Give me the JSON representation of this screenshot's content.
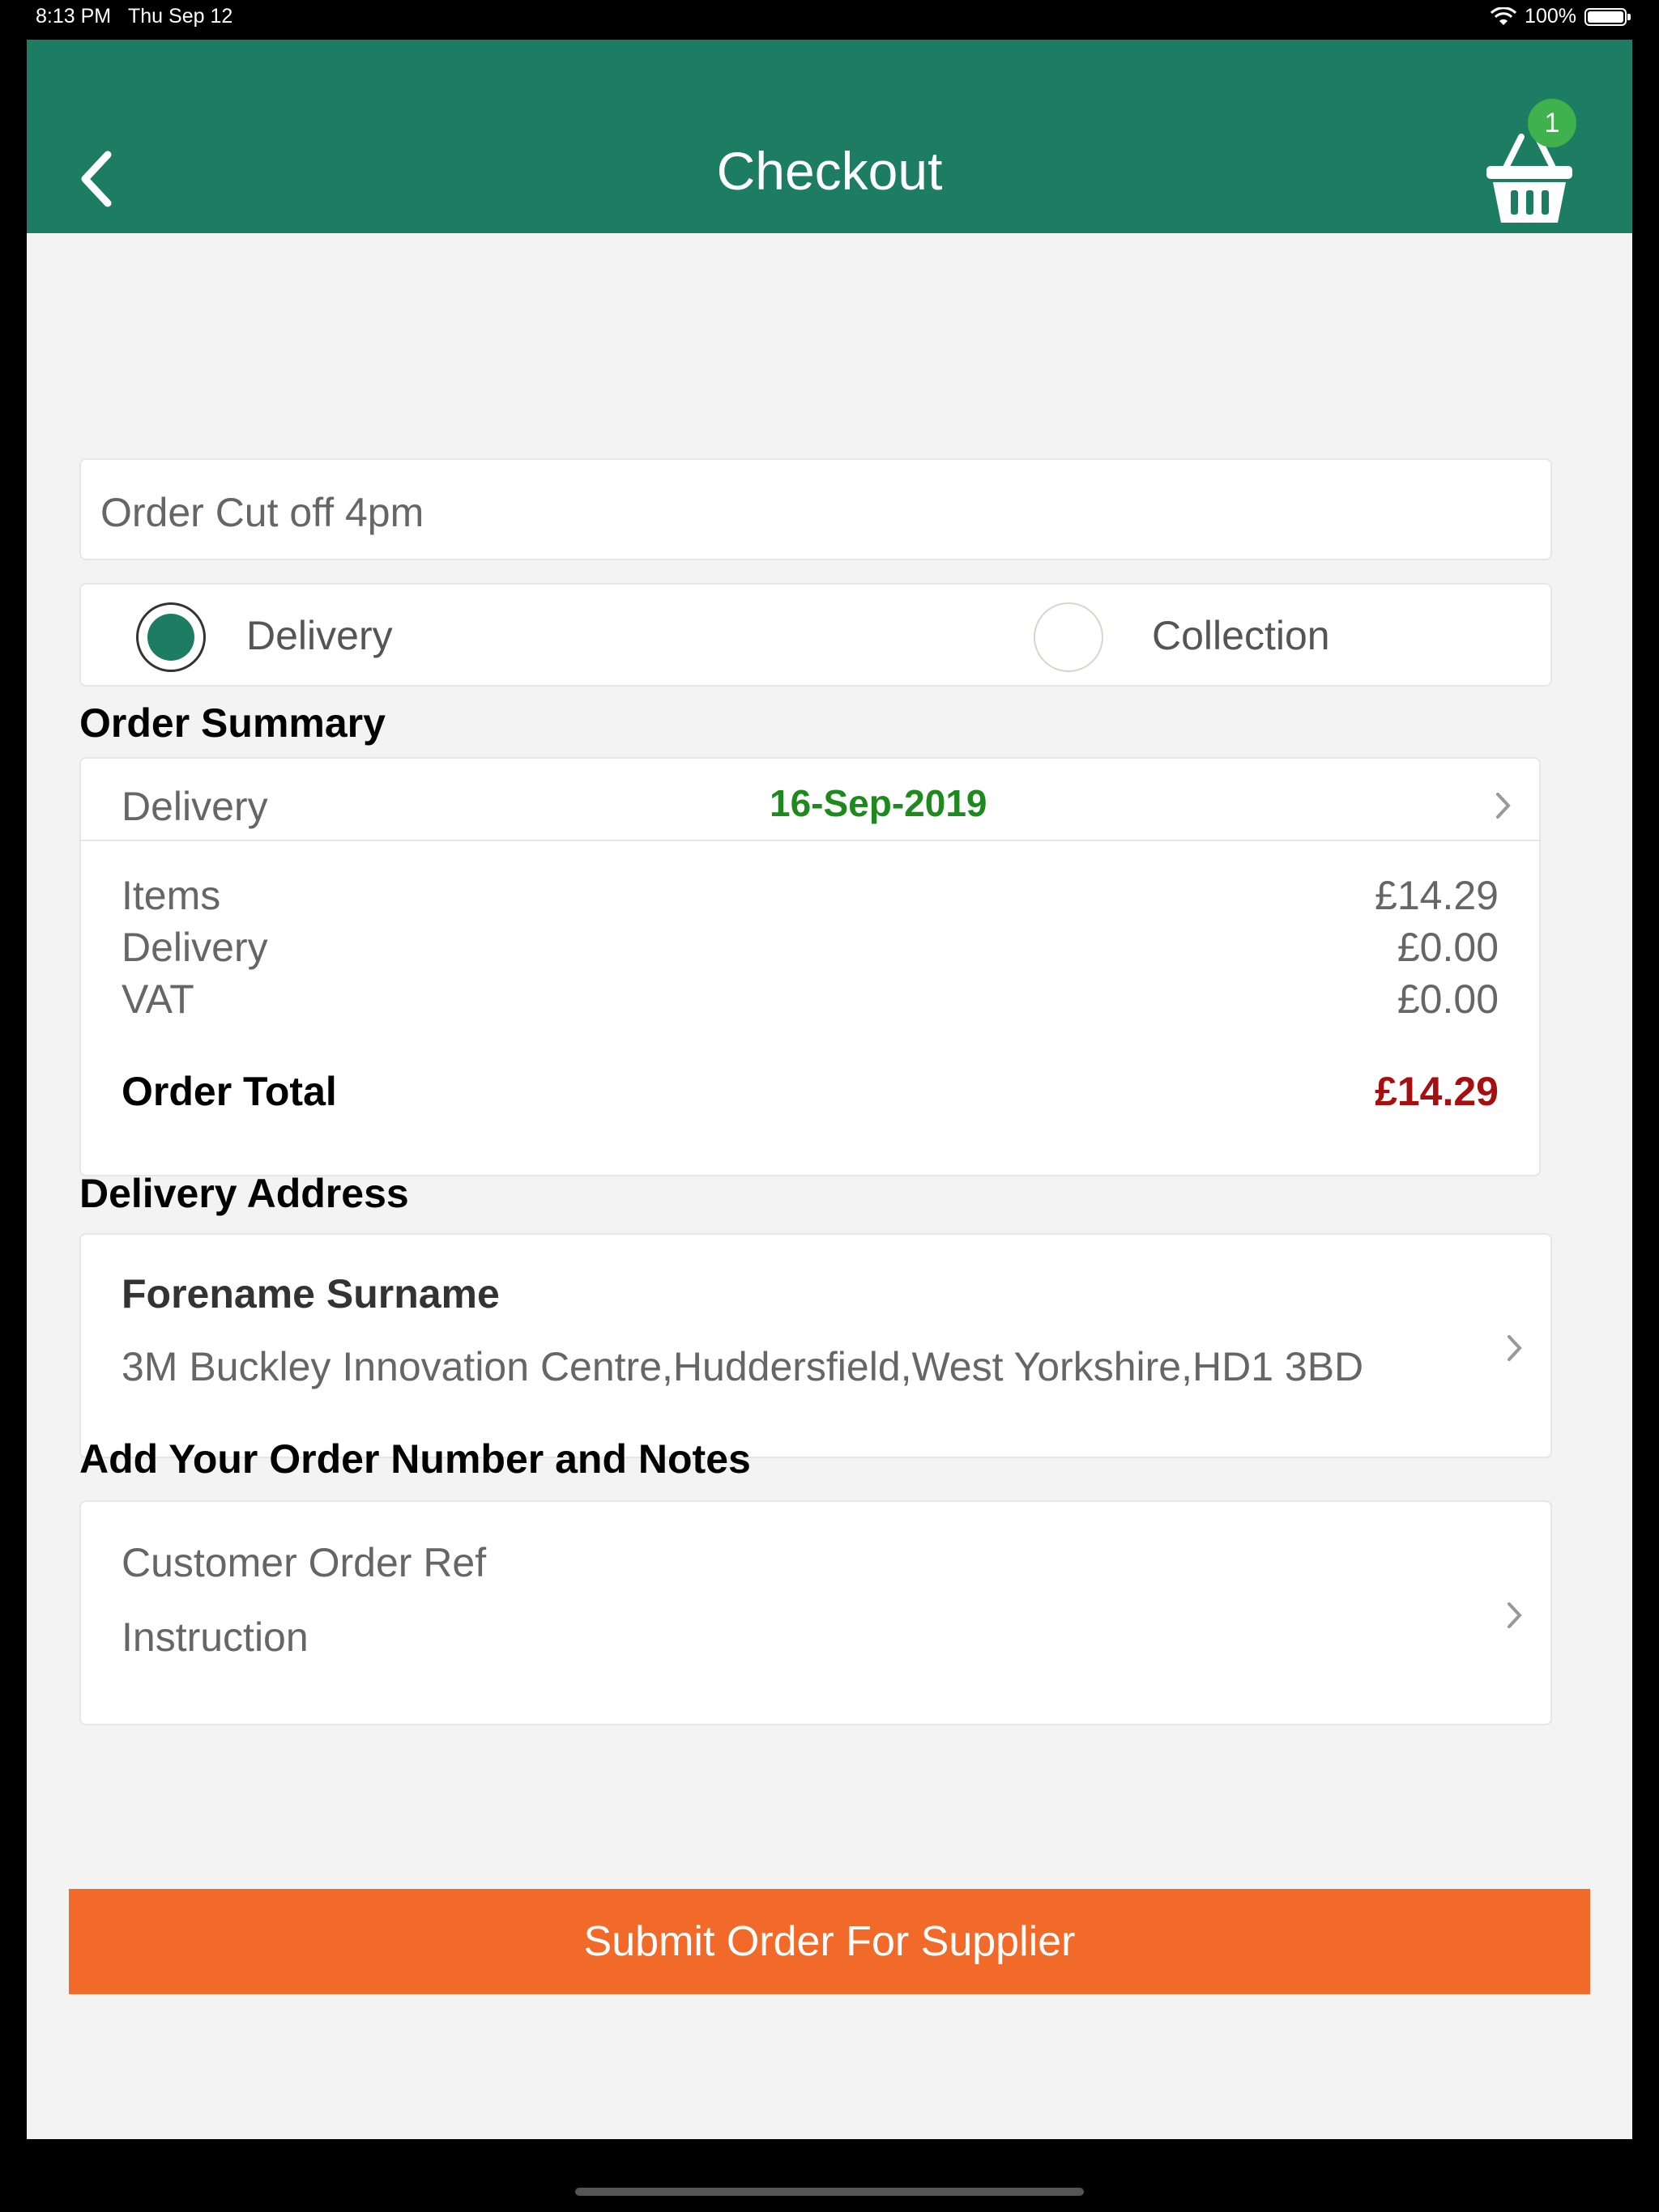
{
  "status_bar": {
    "time": "8:13 PM",
    "date": "Thu Sep 12",
    "battery": "100%"
  },
  "header": {
    "title": "Checkout",
    "cart_count": "1",
    "back_icon": "chevron-left-icon",
    "cart_icon": "basket-icon"
  },
  "cutoff": {
    "text": "Order Cut off 4pm"
  },
  "fulfillment": {
    "options": [
      {
        "label": "Delivery",
        "selected": true
      },
      {
        "label": "Collection",
        "selected": false
      }
    ]
  },
  "order_summary": {
    "heading": "Order Summary",
    "delivery_label": "Delivery",
    "delivery_date": "16-Sep-2019",
    "lines": [
      {
        "label": "Items",
        "value": "£14.29"
      },
      {
        "label": "Delivery",
        "value": "£0.00"
      },
      {
        "label": "VAT",
        "value": "£0.00"
      }
    ],
    "total_label": "Order Total",
    "total_value": "£14.29"
  },
  "delivery_address": {
    "heading": "Delivery Address",
    "name": "Forename Surname",
    "address": "3M Buckley Innovation Centre,Huddersfield,West Yorkshire,HD1 3BD"
  },
  "notes": {
    "heading": "Add Your Order Number and Notes",
    "ref_label": "Customer Order Ref",
    "instruction_label": "Instruction"
  },
  "submit": {
    "label": "Submit Order For Supplier"
  },
  "colors": {
    "primary": "#1d7d62",
    "accent": "#f26a29",
    "date_green": "#1e8a1e",
    "total_red": "#a50f0f",
    "badge": "#3fb24d"
  }
}
